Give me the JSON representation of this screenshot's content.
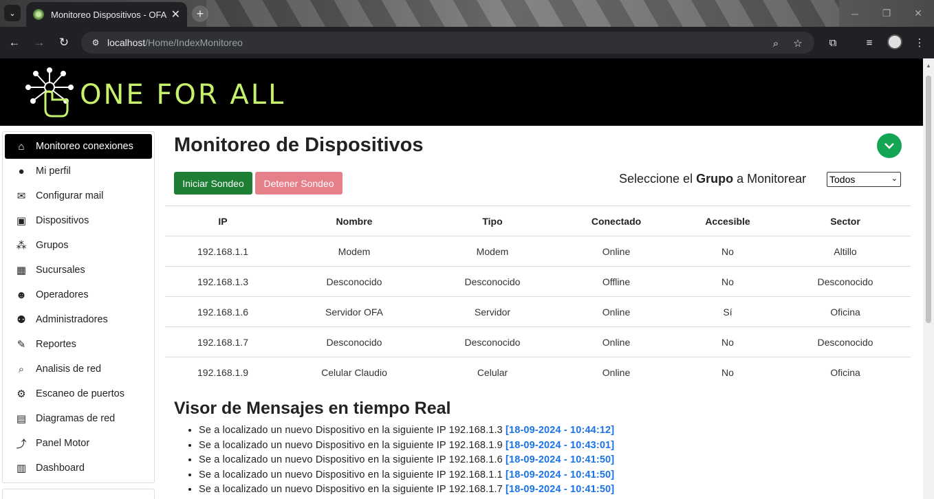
{
  "browser": {
    "tab_title": "Monitoreo Dispositivos - OFA",
    "url_host": "localhost",
    "url_path": "/Home/IndexMonitoreo"
  },
  "header": {
    "brand": "ONE FOR ALL",
    "brand_color": "#c6f26b"
  },
  "sidebar": {
    "items": [
      {
        "label": "Monitoreo conexiones",
        "icon": "home-icon",
        "active": true
      },
      {
        "label": "Mi perfil",
        "icon": "user-icon"
      },
      {
        "label": "Configurar mail",
        "icon": "mail-icon"
      },
      {
        "label": "Dispositivos",
        "icon": "devices-icon"
      },
      {
        "label": "Grupos",
        "icon": "groups-icon"
      },
      {
        "label": "Sucursales",
        "icon": "store-icon"
      },
      {
        "label": "Operadores",
        "icon": "operator-icon"
      },
      {
        "label": "Administradores",
        "icon": "admins-icon"
      },
      {
        "label": "Reportes",
        "icon": "report-icon"
      },
      {
        "label": "Analisis de red",
        "icon": "network-search-icon"
      },
      {
        "label": "Escaneo de puertos",
        "icon": "port-scan-icon"
      },
      {
        "label": "Diagramas de red",
        "icon": "diagram-icon"
      },
      {
        "label": "Panel Motor",
        "icon": "motor-icon"
      },
      {
        "label": "Dashboard",
        "icon": "dashboard-icon"
      }
    ]
  },
  "main": {
    "title": "Monitoreo de Dispositivos",
    "start_label": "Iniciar Sondeo",
    "stop_label": "Detener Sondeo",
    "group_prefix": "Seleccione el",
    "group_bold": "Grupo",
    "group_suffix": "a Monitorear",
    "group_selected": "Todos",
    "accent_start": "#1e7e34",
    "accent_stop": "#e57f8a"
  },
  "table": {
    "headers": [
      "IP",
      "Nombre",
      "Tipo",
      "Conectado",
      "Accesible",
      "Sector"
    ],
    "rows": [
      [
        "192.168.1.1",
        "Modem",
        "Modem",
        "Online",
        "No",
        "Altillo"
      ],
      [
        "192.168.1.3",
        "Desconocido",
        "Desconocido",
        "Offline",
        "No",
        "Desconocido"
      ],
      [
        "192.168.1.6",
        "Servidor OFA",
        "Servidor",
        "Online",
        "Sí",
        "Oficina"
      ],
      [
        "192.168.1.7",
        "Desconocido",
        "Desconocido",
        "Online",
        "No",
        "Desconocido"
      ],
      [
        "192.168.1.9",
        "Celular Claudio",
        "Celular",
        "Online",
        "No",
        "Oficina"
      ]
    ]
  },
  "visor": {
    "title": "Visor de Mensajes en tiempo Real",
    "messages": [
      {
        "text": "Se a localizado un nuevo Dispositivo en la siguiente IP 192.168.1.3",
        "time": "[18-09-2024 - 10:44:12]"
      },
      {
        "text": "Se a localizado un nuevo Dispositivo en la siguiente IP 192.168.1.9",
        "time": "[18-09-2024 - 10:43:01]"
      },
      {
        "text": "Se a localizado un nuevo Dispositivo en la siguiente IP 192.168.1.6",
        "time": "[18-09-2024 - 10:41:50]"
      },
      {
        "text": "Se a localizado un nuevo Dispositivo en la siguiente IP 192.168.1.1",
        "time": "[18-09-2024 - 10:41:50]"
      },
      {
        "text": "Se a localizado un nuevo Dispositivo en la siguiente IP 192.168.1.7",
        "time": "[18-09-2024 - 10:41:50]"
      }
    ]
  }
}
